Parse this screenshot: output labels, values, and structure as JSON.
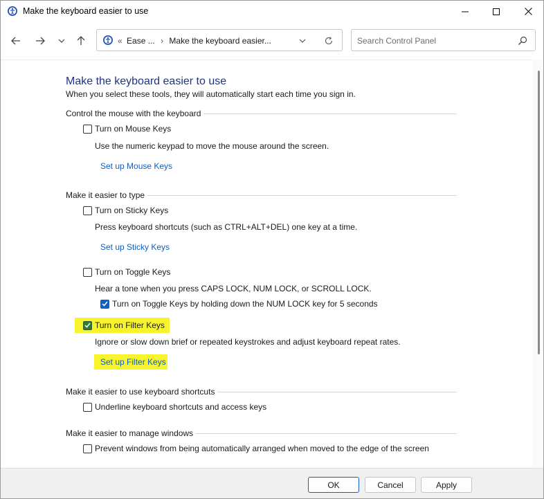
{
  "window": {
    "title": "Make the keyboard easier to use"
  },
  "nav": {
    "breadcrumb_prefix": "«",
    "breadcrumb_1": "Ease ...",
    "breadcrumb_sep": "›",
    "breadcrumb_2": "Make the keyboard easier...",
    "search_placeholder": "Search Control Panel"
  },
  "main": {
    "title": "Make the keyboard easier to use",
    "subtitle": "When you select these tools, they will automatically start each time you sign in.",
    "sections": {
      "mouse": {
        "heading": "Control the mouse with the keyboard",
        "mouse_keys_label": "Turn on Mouse Keys",
        "mouse_keys_checked": false,
        "mouse_keys_desc": "Use the numeric keypad to move the mouse around the screen.",
        "mouse_keys_link": "Set up Mouse Keys"
      },
      "typing": {
        "heading": "Make it easier to type",
        "sticky_label": "Turn on Sticky Keys",
        "sticky_checked": false,
        "sticky_desc": "Press keyboard shortcuts (such as CTRL+ALT+DEL) one key at a time.",
        "sticky_link": "Set up Sticky Keys",
        "toggle_label": "Turn on Toggle Keys",
        "toggle_checked": false,
        "toggle_desc": "Hear a tone when you press CAPS LOCK, NUM LOCK, or SCROLL LOCK.",
        "toggle_hold_label": "Turn on Toggle Keys by holding down the NUM LOCK key for 5 seconds",
        "toggle_hold_checked": true,
        "filter_label": "Turn on Filter Keys",
        "filter_checked": true,
        "filter_desc": "Ignore or slow down brief or repeated keystrokes and adjust keyboard repeat rates.",
        "filter_link": "Set up Filter Keys"
      },
      "shortcuts": {
        "heading": "Make it easier to use keyboard shortcuts",
        "underline_label": "Underline keyboard shortcuts and access keys",
        "underline_checked": false
      },
      "windows": {
        "heading": "Make it easier to manage windows",
        "prevent_label": "Prevent windows from being automatically arranged when moved to the edge of the screen",
        "prevent_checked": false
      }
    }
  },
  "footer": {
    "ok": "OK",
    "cancel": "Cancel",
    "apply": "Apply"
  },
  "colors": {
    "accent": "#0f5fc4",
    "link": "#0b5ec2",
    "title": "#1e3287",
    "highlight": "#f8f42c"
  }
}
